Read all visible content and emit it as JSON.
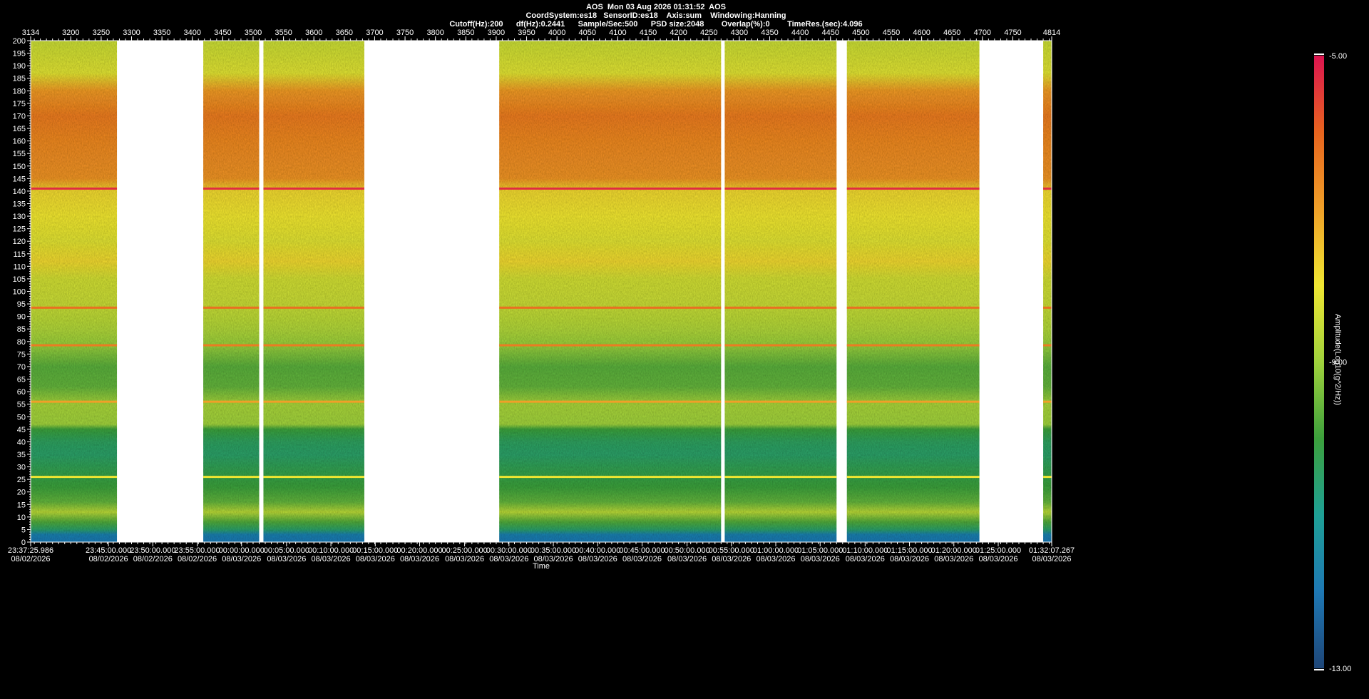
{
  "header": {
    "line1": "AOS  Mon 03 Aug 2026 01:31:52  AOS",
    "line2": "CoordSystem:es18   SensorID:es18    Axis:sum    Windowing:Hanning",
    "line3": "Cutoff(Hz):200      df(Hz):0.2441      Sample/Sec:500      PSD size:2048        Overlap(%):0        TimeRes.(sec):4.096"
  },
  "chart_data": {
    "type": "heatmap",
    "title": "AOS  Mon 03 Aug 2026 01:31:52  AOS",
    "ylabel": "",
    "xlabel": "Time",
    "colorbar_label": "Amplitude(Log10(g^2/Hz))",
    "ylim": [
      0,
      200
    ],
    "y_ticks": [
      0,
      5,
      10,
      15,
      20,
      25,
      30,
      35,
      40,
      45,
      50,
      55,
      60,
      65,
      70,
      75,
      80,
      85,
      90,
      95,
      100,
      105,
      110,
      115,
      120,
      125,
      130,
      135,
      140,
      145,
      150,
      155,
      160,
      165,
      170,
      175,
      180,
      185,
      190,
      195,
      200
    ],
    "top_axis_range": [
      3134,
      4814
    ],
    "top_ticks": [
      3134,
      3200,
      3250,
      3300,
      3350,
      3400,
      3450,
      3500,
      3550,
      3600,
      3650,
      3700,
      3750,
      3800,
      3850,
      3900,
      3950,
      4000,
      4050,
      4100,
      4150,
      4200,
      4250,
      4300,
      4350,
      4400,
      4450,
      4500,
      4550,
      4600,
      4650,
      4700,
      4750,
      4814
    ],
    "bottom_ticks": [
      {
        "v": 3134,
        "time": "23:37:25.986",
        "date": "08/02/2026"
      },
      {
        "v": 3262,
        "time": "23:45:00.000",
        "date": "08/02/2026"
      },
      {
        "v": 3335,
        "time": "23:50:00.000",
        "date": "08/02/2026"
      },
      {
        "v": 3408,
        "time": "23:55:00.000",
        "date": "08/02/2026"
      },
      {
        "v": 3481,
        "time": "00:00:00.000",
        "date": "08/03/2026"
      },
      {
        "v": 3555,
        "time": "00:05:00.000",
        "date": "08/03/2026"
      },
      {
        "v": 3628,
        "time": "00:10:00.000",
        "date": "08/03/2026"
      },
      {
        "v": 3701,
        "time": "00:15:00.000",
        "date": "08/03/2026"
      },
      {
        "v": 3774,
        "time": "00:20:00.000",
        "date": "08/03/2026"
      },
      {
        "v": 3848,
        "time": "00:25:00.000",
        "date": "08/03/2026"
      },
      {
        "v": 3921,
        "time": "00:30:00.000",
        "date": "08/03/2026"
      },
      {
        "v": 3994,
        "time": "00:35:00.000",
        "date": "08/03/2026"
      },
      {
        "v": 4067,
        "time": "00:40:00.000",
        "date": "08/03/2026"
      },
      {
        "v": 4140,
        "time": "00:45:00.000",
        "date": "08/03/2026"
      },
      {
        "v": 4214,
        "time": "00:50:00.000",
        "date": "08/03/2026"
      },
      {
        "v": 4287,
        "time": "00:55:00.000",
        "date": "08/03/2026"
      },
      {
        "v": 4360,
        "time": "01:00:00.000",
        "date": "08/03/2026"
      },
      {
        "v": 4433,
        "time": "01:05:00.000",
        "date": "08/03/2026"
      },
      {
        "v": 4507,
        "time": "01:10:00.000",
        "date": "08/03/2026"
      },
      {
        "v": 4580,
        "time": "01:15:00.000",
        "date": "08/03/2026"
      },
      {
        "v": 4653,
        "time": "01:20:00.000",
        "date": "08/03/2026"
      },
      {
        "v": 4726,
        "time": "01:25:00.000",
        "date": "08/03/2026"
      },
      {
        "v": 4814,
        "time": "01:32:07.267",
        "date": "08/03/2026"
      }
    ],
    "data_segments": [
      {
        "start": 3134,
        "end": 3276
      },
      {
        "start": 3418,
        "end": 3510
      },
      {
        "start": 3517,
        "end": 3683
      },
      {
        "start": 3905,
        "end": 4270
      },
      {
        "start": 4276,
        "end": 4460
      },
      {
        "start": 4477,
        "end": 4695
      },
      {
        "start": 4800,
        "end": 4814
      }
    ],
    "colorbar": {
      "min": -13.0,
      "max": -5.0,
      "ticks": [
        "-5.00",
        "-9.00",
        "-13.00"
      ],
      "colors": [
        "#dc1450",
        "#e8641e",
        "#f0a028",
        "#f0e632",
        "#a0d23c",
        "#3ca03c",
        "#1ea096",
        "#1e78b4",
        "#1e4678"
      ]
    },
    "band_profile": [
      {
        "f": 0,
        "level": -12.0
      },
      {
        "f": 3,
        "level": -11.8
      },
      {
        "f": 5,
        "level": -10.5
      },
      {
        "f": 8,
        "level": -9.8
      },
      {
        "f": 12,
        "level": -8.7
      },
      {
        "f": 16,
        "level": -9.6
      },
      {
        "f": 22,
        "level": -10.0
      },
      {
        "f": 28,
        "level": -10.2
      },
      {
        "f": 35,
        "level": -10.5
      },
      {
        "f": 40,
        "level": -10.4
      },
      {
        "f": 45,
        "level": -10.0
      },
      {
        "f": 47,
        "level": -9.0
      },
      {
        "f": 55,
        "level": -8.9
      },
      {
        "f": 62,
        "level": -9.6
      },
      {
        "f": 70,
        "level": -9.7
      },
      {
        "f": 78,
        "level": -9.1
      },
      {
        "f": 85,
        "level": -8.8
      },
      {
        "f": 95,
        "level": -8.5
      },
      {
        "f": 105,
        "level": -8.4
      },
      {
        "f": 112,
        "level": -7.8
      },
      {
        "f": 120,
        "level": -8.2
      },
      {
        "f": 130,
        "level": -8.0
      },
      {
        "f": 140,
        "level": -7.8
      },
      {
        "f": 145,
        "level": -6.8
      },
      {
        "f": 160,
        "level": -6.6
      },
      {
        "f": 170,
        "level": -6.4
      },
      {
        "f": 180,
        "level": -6.9
      },
      {
        "f": 187,
        "level": -8.2
      },
      {
        "f": 200,
        "level": -8.5
      }
    ],
    "tonal_lines": [
      {
        "f": 141,
        "level": -5.3
      },
      {
        "f": 93.5,
        "level": -6.2
      },
      {
        "f": 78.5,
        "level": -6.4
      },
      {
        "f": 56,
        "level": -7.0
      },
      {
        "f": 26,
        "level": -8.0
      }
    ]
  }
}
